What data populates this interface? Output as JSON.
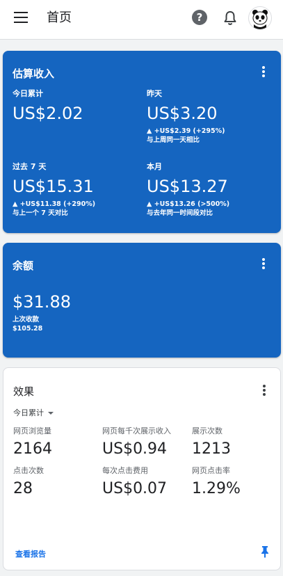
{
  "header": {
    "title": "首页"
  },
  "estimated": {
    "title": "估算收入",
    "items": [
      {
        "label": "今日累计",
        "value": "US$2.02",
        "delta": "",
        "compare": ""
      },
      {
        "label": "昨天",
        "value": "US$3.20",
        "delta": "▲ +US$2.39 (+295%)",
        "compare": "与上周同一天相比"
      },
      {
        "label": "过去 7 天",
        "value": "US$15.31",
        "delta": "▲ +US$11.38 (+290%)",
        "compare": "与上一个 7 天对比"
      },
      {
        "label": "本月",
        "value": "US$13.27",
        "delta": "▲ +US$13.26 (>500%)",
        "compare": "与去年同一时间段对比"
      }
    ]
  },
  "balance": {
    "title": "余额",
    "amount": "$31.88",
    "last_payment_label": "上次收款",
    "last_payment_value": "$105.28"
  },
  "performance": {
    "title": "效果",
    "range": "今日累计",
    "metrics": [
      {
        "label": "网页浏览量",
        "value": "2164"
      },
      {
        "label": "网页每千次展示收入",
        "value": "US$0.94"
      },
      {
        "label": "展示次数",
        "value": "1213"
      },
      {
        "label": "点击次数",
        "value": "28"
      },
      {
        "label": "每次点击费用",
        "value": "US$0.07"
      },
      {
        "label": "网页点击率",
        "value": "1.29%"
      }
    ],
    "report_link": "查看报告"
  },
  "colors": {
    "card_blue": "#1565c0",
    "link": "#1a73e8"
  }
}
